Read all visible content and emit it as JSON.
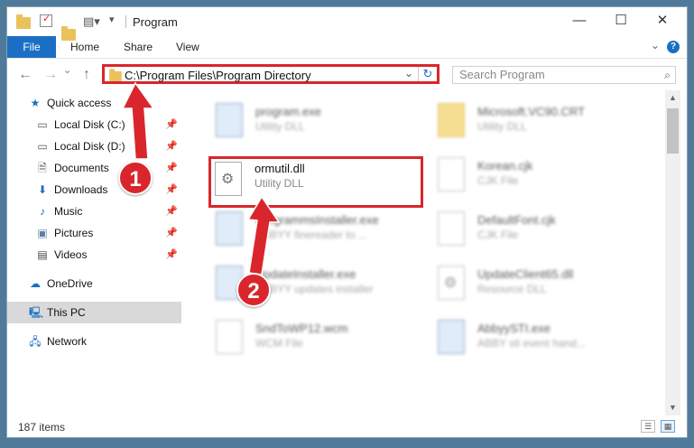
{
  "window": {
    "title": "Program"
  },
  "ribbon": {
    "tabs": [
      "File",
      "Home",
      "Share",
      "View"
    ],
    "help": "?"
  },
  "address": {
    "path": "C:\\Program Files\\Program Directory"
  },
  "search": {
    "placeholder": "Search Program"
  },
  "sidebar": {
    "items": [
      {
        "label": "Quick access",
        "icon": "star-icon",
        "pinned": false
      },
      {
        "label": "Local Disk (C:)",
        "icon": "drive-icon",
        "pinned": true
      },
      {
        "label": "Local Disk (D:)",
        "icon": "drive-icon",
        "pinned": true
      },
      {
        "label": "Documents",
        "icon": "document-icon",
        "pinned": true
      },
      {
        "label": "Downloads",
        "icon": "download-icon",
        "pinned": true
      },
      {
        "label": "Music",
        "icon": "music-icon",
        "pinned": true
      },
      {
        "label": "Pictures",
        "icon": "pictures-icon",
        "pinned": true
      },
      {
        "label": "Videos",
        "icon": "video-icon",
        "pinned": true
      },
      {
        "label": "OneDrive",
        "icon": "cloud-icon",
        "pinned": false
      },
      {
        "label": "This PC",
        "icon": "computer-icon",
        "pinned": false,
        "selected": true
      },
      {
        "label": "Network",
        "icon": "network-icon",
        "pinned": false
      }
    ]
  },
  "files": [
    {
      "name": "program.exe",
      "type": "Utility DLL",
      "icon": "application-icon"
    },
    {
      "name": "Microsoft.VC90.CRT",
      "type": "Utility DLL",
      "icon": "folder-icon"
    },
    {
      "name": "ormutil.dll",
      "type": "Utility DLL",
      "icon": "dll-gear-icon",
      "highlighted": true
    },
    {
      "name": "Korean.cjk",
      "type": "CJK File",
      "icon": "file-icon"
    },
    {
      "name": "ProgrammsInstaller.exe",
      "type": "ABBYY finereader to ...",
      "icon": "application-icon"
    },
    {
      "name": "DefaultFont.cjk",
      "type": "CJK File",
      "icon": "file-icon"
    },
    {
      "name": "UpdateInstaller.exe",
      "type": "ABBYY updates installer",
      "icon": "application-icon"
    },
    {
      "name": "UpdateClient65.dll",
      "type": "Resource DLL",
      "icon": "dll-gear-icon"
    },
    {
      "name": "SndToWP12.wcm",
      "type": "WCM File",
      "icon": "file-icon"
    },
    {
      "name": "AbbyySTI.exe",
      "type": "ABBY sti event hand...",
      "icon": "application-icon"
    }
  ],
  "status": {
    "count": "187 items"
  },
  "callouts": {
    "one": "1",
    "two": "2"
  },
  "colors": {
    "accent": "#1a6fc4",
    "highlight": "#d9262c"
  }
}
